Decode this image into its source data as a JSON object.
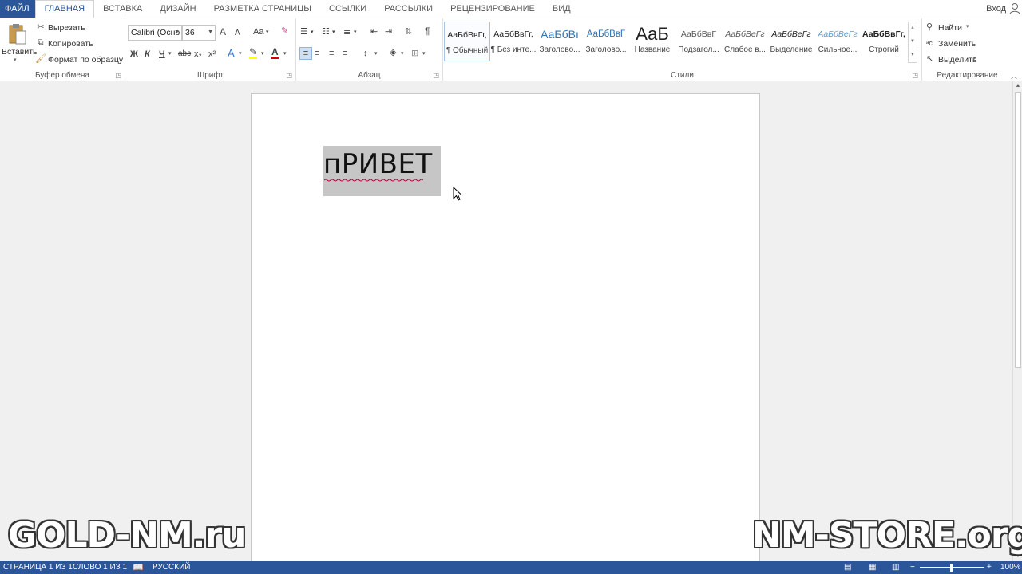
{
  "tabs": [
    {
      "label": "ФАЙЛ"
    },
    {
      "label": "ГЛАВНАЯ"
    },
    {
      "label": "ВСТАВКА"
    },
    {
      "label": "ДИЗАЙН"
    },
    {
      "label": "РАЗМЕТКА СТРАНИЦЫ"
    },
    {
      "label": "ССЫЛКИ"
    },
    {
      "label": "РАССЫЛКИ"
    },
    {
      "label": "РЕЦЕНЗИРОВАНИЕ"
    },
    {
      "label": "ВИД"
    }
  ],
  "signin": "Вход",
  "clipboard": {
    "paste": "Вставить",
    "cut": "Вырезать",
    "copy": "Копировать",
    "format_painter": "Формат по образцу",
    "label": "Буфер обмена"
  },
  "font": {
    "name": "Calibri (Осно",
    "size": "36",
    "grow": "A",
    "shrink": "A",
    "case": "Aa",
    "bold": "Ж",
    "italic": "К",
    "underline": "Ч",
    "strike": "abc",
    "subscript": "x₂",
    "superscript": "x²",
    "label": "Шрифт"
  },
  "paragraph": {
    "label": "Абзац",
    "pilcrow": "¶"
  },
  "styles": {
    "label": "Стили",
    "items": [
      {
        "sample": "АаБбВвГг,",
        "name": "¶ Обычный"
      },
      {
        "sample": "АаБбВвГг,",
        "name": "¶ Без инте..."
      },
      {
        "sample": "АаБбВı",
        "name": "Заголово..."
      },
      {
        "sample": "АаБбВвГ",
        "name": "Заголово..."
      },
      {
        "sample": "АаБ",
        "name": "Название"
      },
      {
        "sample": "АаБбВвГ",
        "name": "Подзагол..."
      },
      {
        "sample": "АаБбВеГг",
        "name": "Слабое в..."
      },
      {
        "sample": "АаБбВеГг",
        "name": "Выделение"
      },
      {
        "sample": "АаБбВеГг",
        "name": "Сильное..."
      },
      {
        "sample": "АаБбВвГг,",
        "name": "Строгий"
      }
    ]
  },
  "editing": {
    "find": "Найти",
    "replace": "Заменить",
    "select": "Выделить",
    "label": "Редактирование"
  },
  "document": {
    "text": "пРИВЕТ"
  },
  "watermarks": {
    "left": "GOLD-NM.ru",
    "right": "NM-STORE.org"
  },
  "status": {
    "page": "СТРАНИЦА 1 ИЗ 1",
    "words": "СЛОВО 1 ИЗ 1",
    "language": "РУССКИЙ",
    "zoom": "100%"
  },
  "colors": {
    "accent": "#2b579a",
    "selection": "#c6c6c6",
    "font_color": "#d00000",
    "highlight": "#ffff00"
  }
}
